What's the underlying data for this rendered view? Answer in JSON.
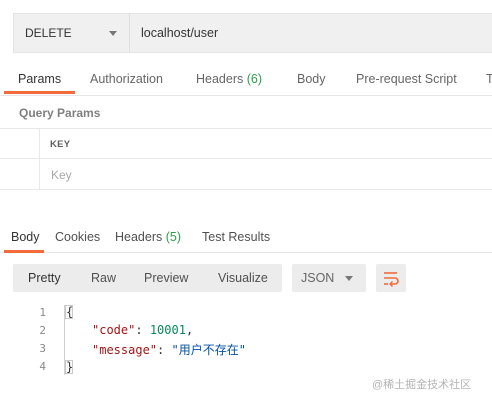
{
  "request": {
    "method": "DELETE",
    "url": "localhost/user"
  },
  "request_tabs": {
    "params": "Params",
    "authorization": "Authorization",
    "headers": "Headers",
    "headers_count": "(6)",
    "body": "Body",
    "prerequest": "Pre-request Script",
    "tests": "T"
  },
  "query_params": {
    "title": "Query Params",
    "key_header": "KEY",
    "key_placeholder": "Key"
  },
  "response_tabs": {
    "body": "Body",
    "cookies": "Cookies",
    "headers": "Headers",
    "headers_count": "(5)",
    "test_results": "Test Results"
  },
  "viewer": {
    "pretty": "Pretty",
    "raw": "Raw",
    "preview": "Preview",
    "visualize": "Visualize",
    "format": "JSON"
  },
  "response_body": {
    "line_numbers": [
      "1",
      "2",
      "3",
      "4"
    ],
    "open_brace": "{",
    "close_brace": "}",
    "code_key": "\"code\"",
    "code_value": "10001",
    "message_key": "\"message\"",
    "message_value": "\"用户不存在\""
  },
  "watermark": "@稀土掘金技术社区",
  "colors": {
    "accent": "#f26b3a",
    "count_green": "#2e9e4a"
  }
}
